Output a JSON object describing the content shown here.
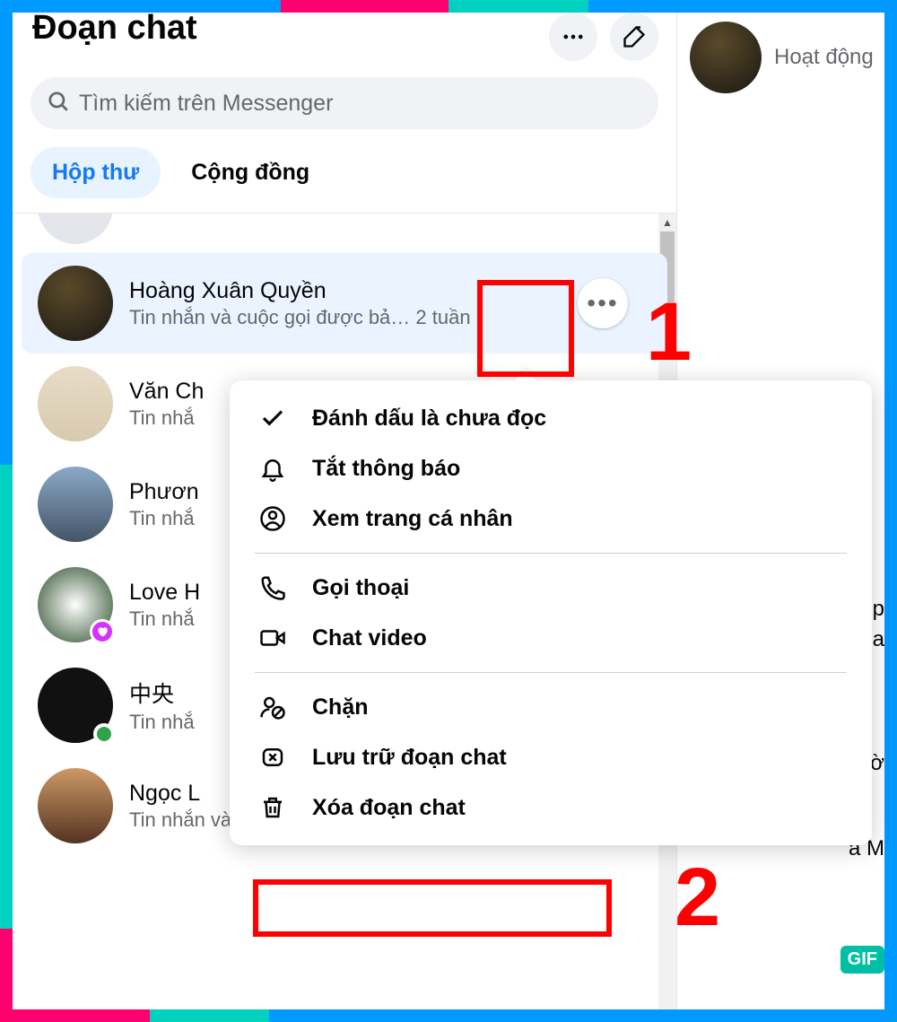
{
  "header": {
    "title": "Đoạn chat"
  },
  "search": {
    "placeholder": "Tìm kiếm trên Messenger"
  },
  "tabs": {
    "inbox": "Hộp thư",
    "community": "Cộng đồng"
  },
  "conversations": [
    {
      "name": "Hoàng Xuân Quyền",
      "sub": "Tin nhắn và cuộc gọi được bả…   2 tuần"
    },
    {
      "name": "Văn Ch",
      "sub": "Tin nhắ"
    },
    {
      "name": "Phươn",
      "sub": "Tin nhắ"
    },
    {
      "name": "Love H",
      "sub": "Tin nhắ"
    },
    {
      "name": "中央",
      "sub": "Tin nhắ"
    },
    {
      "name": "Ngọc L",
      "sub": "Tin nhắn và cuộc"
    }
  ],
  "popup": {
    "mark_unread": "Đánh dấu là chưa đọc",
    "mute": "Tắt thông báo",
    "view_profile": "Xem trang cá nhân",
    "audio_call": "Gọi thoại",
    "video_chat": "Chat video",
    "block": "Chặn",
    "archive": "Lưu trữ đoạn chat",
    "delete": "Xóa đoạn chat"
  },
  "right": {
    "status": "Hoạt động",
    "frag1_a": "p",
    "frag1_b": "a",
    "frag2": "Giờ",
    "frag3": "à M",
    "gif": "GIF"
  },
  "annotations": {
    "num1": "1",
    "num2": "2"
  }
}
